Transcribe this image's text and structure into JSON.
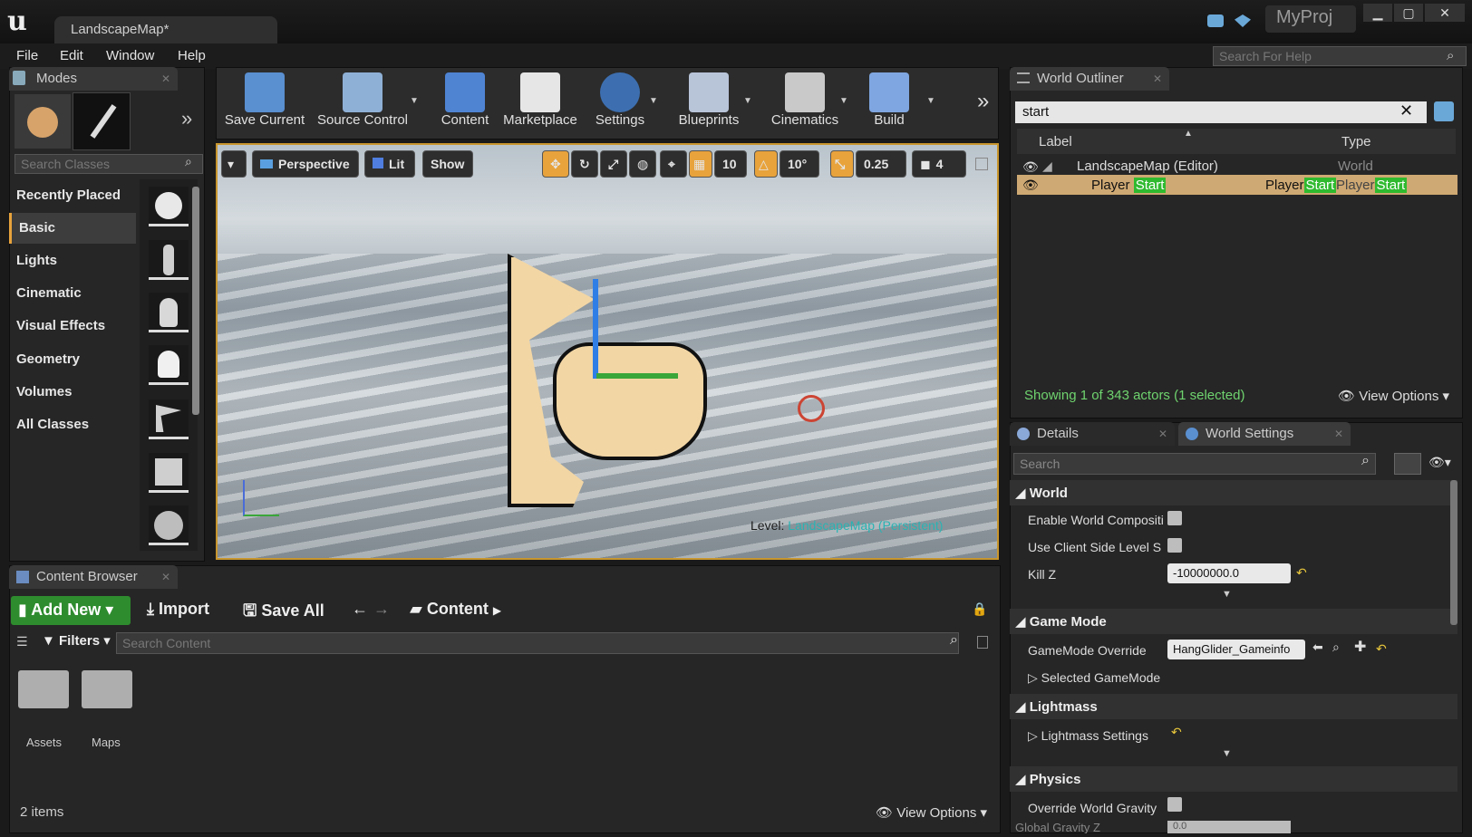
{
  "window": {
    "tab_title": "LandscapeMap*",
    "project": "MyProj"
  },
  "menu": [
    "File",
    "Edit",
    "Window",
    "Help"
  ],
  "help_search_placeholder": "Search For Help",
  "modes": {
    "title": "Modes",
    "search_placeholder": "Search Classes",
    "items": [
      "Recently Placed",
      "Basic",
      "Lights",
      "Cinematic",
      "Visual Effects",
      "Geometry",
      "Volumes",
      "All Classes"
    ],
    "selected": "Basic"
  },
  "toolbar": [
    "Save Current",
    "Source Control",
    "Content",
    "Marketplace",
    "Settings",
    "Blueprints",
    "Cinematics",
    "Build"
  ],
  "viewport": {
    "perspective": "Perspective",
    "lit": "Lit",
    "show": "Show",
    "grid_snap": "10",
    "rot_snap": "10°",
    "scale_snap": "0.25",
    "cam_speed": "4",
    "level_label": "Level:",
    "level_name": "LandscapeMap (Persistent)"
  },
  "outliner": {
    "title": "World Outliner",
    "search": "start",
    "col_label": "Label",
    "col_type": "Type",
    "row1_label": "LandscapeMap (Editor)",
    "row1_type": "World",
    "row2_a": "Player",
    "row2_b": "Start",
    "status": "Showing 1 of 343 actors (1 selected)",
    "view_options": "View Options"
  },
  "details": {
    "tab1": "Details",
    "tab2": "World Settings",
    "search_placeholder": "Search",
    "cat_world": "World",
    "enable_world_comp": "Enable World Compositi",
    "use_client_side": "Use Client Side Level S",
    "kill_z": "Kill Z",
    "kill_z_value": "-10000000.0",
    "cat_game_mode": "Game Mode",
    "gamemode_override": "GameMode Override",
    "gamemode_value": "HangGlider_Gameinfo",
    "selected_gamemode": "Selected GameMode",
    "cat_lightmass": "Lightmass",
    "lightmass_settings": "Lightmass Settings",
    "cat_physics": "Physics",
    "override_gravity": "Override World Gravity",
    "global_gravity": "Global Gravity Z",
    "global_gravity_value": "0.0"
  },
  "content": {
    "title": "Content Browser",
    "add_new": "Add New",
    "import": "Import",
    "save_all": "Save All",
    "path": "Content",
    "filters": "Filters",
    "search_placeholder": "Search Content",
    "folders": [
      "Assets",
      "Maps"
    ],
    "count": "2 items",
    "view_options": "View Options"
  },
  "colors": {
    "accent": "#e8a33c",
    "highlight_green": "#2fba2f",
    "teal_link": "#55c9c9",
    "outliner_sel": "#cfa973"
  }
}
